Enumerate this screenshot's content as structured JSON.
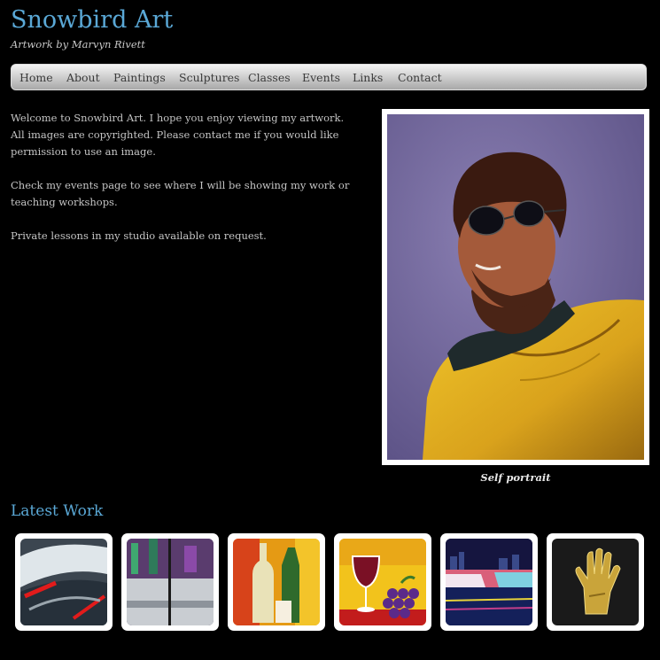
{
  "site": {
    "title": "Snowbird Art",
    "tagline": "Artwork by Marvyn Rivett",
    "title_color": "#5aa8d6"
  },
  "nav": {
    "items": [
      {
        "label": "Home"
      },
      {
        "label": "About"
      },
      {
        "label": "Paintings"
      },
      {
        "label": "Sculptures"
      },
      {
        "label": "Classes"
      },
      {
        "label": "Events"
      },
      {
        "label": "Links"
      },
      {
        "label": "Contact"
      }
    ]
  },
  "intro": {
    "paragraphs": [
      "Welcome to Snowbird Art. I hope you enjoy viewing my artwork. All images are copyrighted. Please contact me if you would like permission to use an image.",
      "Check my events page to see where I will be showing my work or teaching workshops.",
      "Private lessons in my studio available on request."
    ]
  },
  "featured": {
    "caption": "Self portrait"
  },
  "latest_work": {
    "title": "Latest Work",
    "thumbnails": [
      {
        "subject": "abstract-red-streaks"
      },
      {
        "subject": "winter-diptych"
      },
      {
        "subject": "bottle-still-life"
      },
      {
        "subject": "wine-and-grapes"
      },
      {
        "subject": "night-falls-city"
      },
      {
        "subject": "bronze-hand-sculpture"
      }
    ]
  }
}
